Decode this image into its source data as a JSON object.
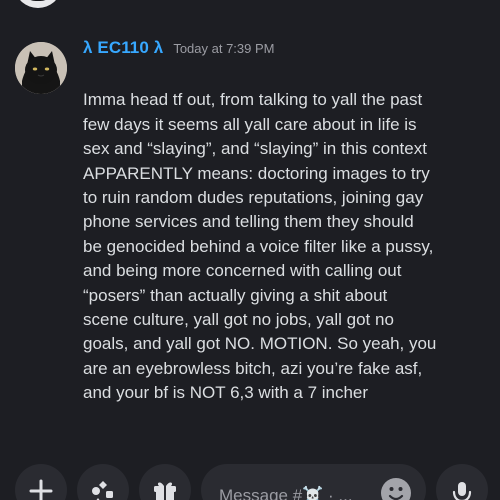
{
  "message": {
    "username": "λ EC110 λ",
    "timestamp": "Today at 7:39 PM",
    "lines": [
      "Imma head tf out, from talking to yall the past",
      "few days it seems  all yall care about in life is",
      "sex and “slaying”, and “slaying” in this context",
      "APPARENTLY means: doctoring images to try",
      "to ruin random dudes reputations, joining gay",
      "phone services and telling them they should",
      "be genocided behind a voice filter like a pussy,",
      "and being more concerned with calling out",
      "“posers” than actually giving a shit about",
      "scene culture, yall got no jobs, yall got no",
      "goals, and yall got NO. MOTION. So yeah, you",
      "are an eyebrowless bitch, azi you’re fake asf,",
      "and your bf is NOT 6,3 with a 7 incher"
    ],
    "avatar_icon": "black-cat-avatar-icon",
    "username_color": "#37a8ff"
  },
  "composer": {
    "placeholder": "Message #☠️ · ...",
    "buttons": {
      "plus": "plus-icon",
      "apps": "apps-icon",
      "gift": "gift-icon",
      "emoji": "emoji-icon",
      "mic": "microphone-icon"
    }
  },
  "colors": {
    "background": "#1d1e23",
    "panel": "#2a2b31",
    "text": "#dbdee1",
    "muted": "#9b9ca3"
  }
}
